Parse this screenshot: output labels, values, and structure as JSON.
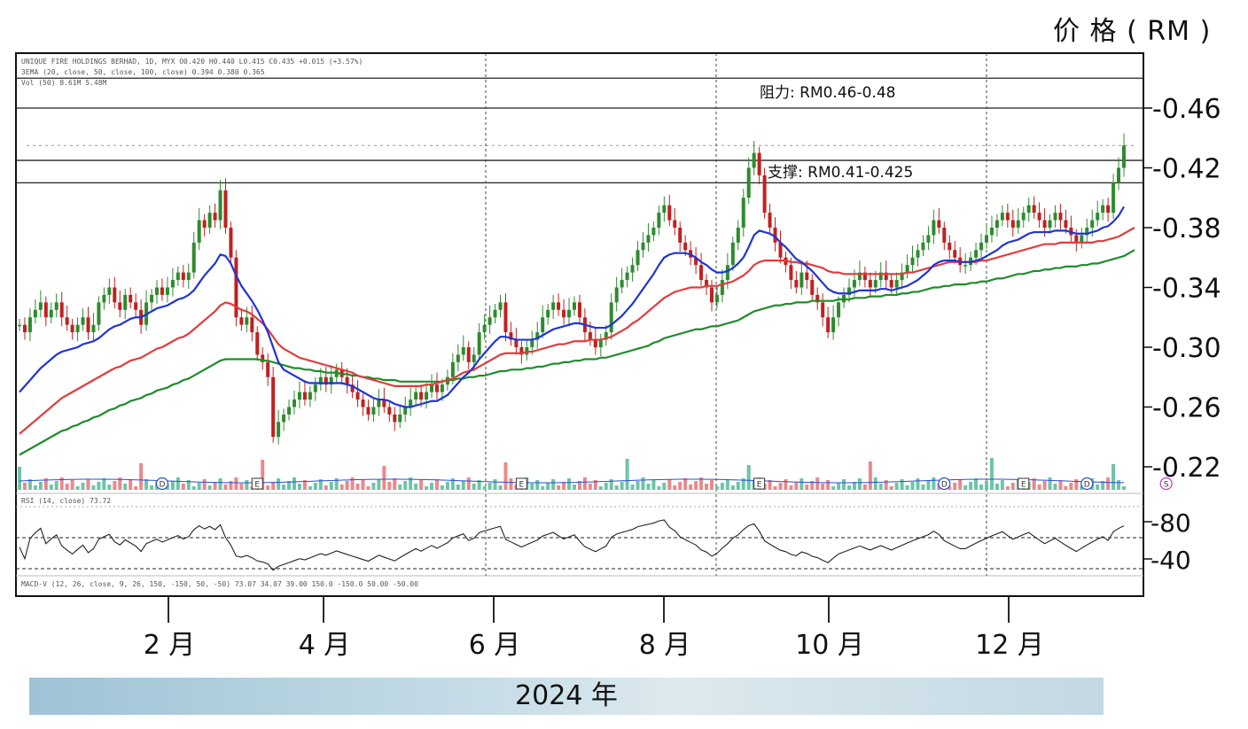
{
  "unit_label": "价 格 ( RM )",
  "header": {
    "line1": "UNIQUE FIRE HOLDINGS BERHAD, 1D, MYX  O0.420  H0.440  L0.415  C0.435  +0.015 (+3.57%)",
    "line2": "3EMA (20, close, 50, close, 100, close)  0.394  0.380  0.365",
    "line3": "Vol (50)  8.61M  5.48M",
    "rsi": "RSI (14, close)  73.72",
    "macd": "MACD-V (12, 26, close, 9, 26, 150, -150, 50, -50)  73.07  34.07  39.00  150.0  -150.0  50.00  -50.00"
  },
  "annotations": {
    "resistance": "阻力: RM0.46-0.48",
    "support": "支撑: RM0.41-0.425"
  },
  "year_label": "2024 年",
  "colors": {
    "ema20": "#1f34d6",
    "ema50": "#e03c3c",
    "ema100": "#1e8c2a",
    "candle_up": "#2e8b2e",
    "candle_down": "#c02020",
    "vol_up": "#6fc4a8",
    "vol_down": "#e88a8a"
  },
  "chart_data": {
    "type": "candlestick",
    "yaxis": {
      "ticks": [
        0.46,
        0.42,
        0.38,
        0.34,
        0.3,
        0.26,
        0.22
      ],
      "ylim": [
        0.21,
        0.48
      ]
    },
    "rsi_axis": {
      "ticks": [
        80,
        40
      ],
      "ylim": [
        20,
        100
      ]
    },
    "xaxis": {
      "ticks": [
        "2 月",
        "4 月",
        "6 月",
        "8 月",
        "10 月",
        "12 月"
      ],
      "tick_index": [
        33,
        66,
        98,
        130,
        162,
        197
      ]
    },
    "resistance_lines": [
      0.46,
      0.48
    ],
    "support_lines": [
      0.41,
      0.425
    ],
    "dotted_level": 0.435,
    "event_lines_index": [
      95,
      146,
      187
    ],
    "event_markers": [
      {
        "i": 27,
        "label": "D"
      },
      {
        "i": 45,
        "label": "E"
      },
      {
        "i": 95,
        "label": "E"
      },
      {
        "i": 140,
        "label": "E"
      },
      {
        "i": 175,
        "label": "D"
      },
      {
        "i": 190,
        "label": "E"
      },
      {
        "i": 202,
        "label": "D"
      },
      {
        "i": 217,
        "label": "S"
      }
    ],
    "close": [
      0.315,
      0.31,
      0.32,
      0.325,
      0.33,
      0.32,
      0.325,
      0.33,
      0.32,
      0.315,
      0.31,
      0.315,
      0.32,
      0.31,
      0.315,
      0.33,
      0.335,
      0.34,
      0.33,
      0.325,
      0.335,
      0.33,
      0.325,
      0.315,
      0.33,
      0.335,
      0.34,
      0.335,
      0.34,
      0.345,
      0.35,
      0.345,
      0.35,
      0.37,
      0.385,
      0.38,
      0.39,
      0.385,
      0.405,
      0.38,
      0.36,
      0.32,
      0.315,
      0.32,
      0.31,
      0.295,
      0.29,
      0.28,
      0.24,
      0.25,
      0.255,
      0.26,
      0.265,
      0.27,
      0.265,
      0.27,
      0.275,
      0.28,
      0.275,
      0.28,
      0.285,
      0.28,
      0.275,
      0.27,
      0.265,
      0.26,
      0.255,
      0.26,
      0.265,
      0.26,
      0.255,
      0.25,
      0.255,
      0.26,
      0.265,
      0.27,
      0.265,
      0.27,
      0.275,
      0.27,
      0.275,
      0.28,
      0.29,
      0.295,
      0.3,
      0.29,
      0.295,
      0.31,
      0.315,
      0.32,
      0.325,
      0.33,
      0.31,
      0.305,
      0.3,
      0.295,
      0.3,
      0.305,
      0.31,
      0.32,
      0.325,
      0.33,
      0.325,
      0.32,
      0.325,
      0.33,
      0.32,
      0.31,
      0.305,
      0.3,
      0.305,
      0.31,
      0.33,
      0.34,
      0.345,
      0.35,
      0.355,
      0.365,
      0.37,
      0.375,
      0.38,
      0.39,
      0.395,
      0.385,
      0.38,
      0.37,
      0.365,
      0.36,
      0.355,
      0.345,
      0.34,
      0.33,
      0.335,
      0.345,
      0.355,
      0.37,
      0.38,
      0.4,
      0.42,
      0.43,
      0.415,
      0.39,
      0.38,
      0.37,
      0.36,
      0.355,
      0.345,
      0.34,
      0.35,
      0.345,
      0.335,
      0.33,
      0.32,
      0.31,
      0.32,
      0.33,
      0.335,
      0.34,
      0.345,
      0.35,
      0.345,
      0.34,
      0.345,
      0.35,
      0.345,
      0.34,
      0.345,
      0.35,
      0.355,
      0.36,
      0.365,
      0.37,
      0.375,
      0.385,
      0.38,
      0.37,
      0.365,
      0.36,
      0.355,
      0.355,
      0.36,
      0.365,
      0.37,
      0.375,
      0.38,
      0.385,
      0.39,
      0.385,
      0.38,
      0.385,
      0.39,
      0.395,
      0.39,
      0.385,
      0.38,
      0.385,
      0.39,
      0.385,
      0.38,
      0.375,
      0.37,
      0.375,
      0.38,
      0.385,
      0.39,
      0.395,
      0.39,
      0.41,
      0.42,
      0.435
    ],
    "ema20": [
      0.27,
      0.274,
      0.278,
      0.282,
      0.286,
      0.289,
      0.292,
      0.295,
      0.297,
      0.298,
      0.299,
      0.3,
      0.302,
      0.303,
      0.304,
      0.306,
      0.309,
      0.312,
      0.314,
      0.315,
      0.317,
      0.319,
      0.32,
      0.32,
      0.322,
      0.324,
      0.326,
      0.327,
      0.328,
      0.33,
      0.332,
      0.333,
      0.335,
      0.338,
      0.343,
      0.348,
      0.352,
      0.356,
      0.362,
      0.361,
      0.356,
      0.348,
      0.341,
      0.336,
      0.331,
      0.325,
      0.318,
      0.31,
      0.3,
      0.29,
      0.285,
      0.283,
      0.281,
      0.279,
      0.277,
      0.276,
      0.276,
      0.276,
      0.276,
      0.276,
      0.276,
      0.276,
      0.275,
      0.274,
      0.272,
      0.27,
      0.268,
      0.266,
      0.265,
      0.265,
      0.264,
      0.262,
      0.261,
      0.26,
      0.26,
      0.261,
      0.262,
      0.263,
      0.264,
      0.264,
      0.266,
      0.268,
      0.272,
      0.276,
      0.28,
      0.283,
      0.287,
      0.292,
      0.296,
      0.3,
      0.304,
      0.307,
      0.307,
      0.306,
      0.305,
      0.305,
      0.305,
      0.305,
      0.306,
      0.308,
      0.31,
      0.312,
      0.313,
      0.314,
      0.315,
      0.316,
      0.316,
      0.315,
      0.314,
      0.313,
      0.313,
      0.313,
      0.315,
      0.318,
      0.321,
      0.325,
      0.329,
      0.334,
      0.339,
      0.344,
      0.349,
      0.355,
      0.36,
      0.362,
      0.363,
      0.363,
      0.363,
      0.362,
      0.36,
      0.357,
      0.355,
      0.352,
      0.35,
      0.35,
      0.351,
      0.353,
      0.356,
      0.36,
      0.367,
      0.375,
      0.378,
      0.377,
      0.376,
      0.374,
      0.37,
      0.367,
      0.363,
      0.359,
      0.357,
      0.354,
      0.351,
      0.347,
      0.343,
      0.339,
      0.337,
      0.336,
      0.336,
      0.336,
      0.337,
      0.338,
      0.338,
      0.338,
      0.338,
      0.339,
      0.339,
      0.338,
      0.339,
      0.34,
      0.341,
      0.343,
      0.345,
      0.348,
      0.351,
      0.355,
      0.357,
      0.358,
      0.358,
      0.358,
      0.357,
      0.357,
      0.357,
      0.358,
      0.359,
      0.361,
      0.363,
      0.365,
      0.368,
      0.37,
      0.371,
      0.372,
      0.374,
      0.376,
      0.377,
      0.377,
      0.377,
      0.377,
      0.378,
      0.378,
      0.378,
      0.377,
      0.376,
      0.376,
      0.376,
      0.377,
      0.378,
      0.38,
      0.381,
      0.384,
      0.388,
      0.394
    ],
    "ema50": [
      0.242,
      0.245,
      0.248,
      0.251,
      0.254,
      0.257,
      0.26,
      0.263,
      0.266,
      0.268,
      0.27,
      0.272,
      0.274,
      0.276,
      0.278,
      0.28,
      0.282,
      0.284,
      0.286,
      0.287,
      0.289,
      0.291,
      0.292,
      0.293,
      0.295,
      0.297,
      0.299,
      0.3,
      0.302,
      0.304,
      0.306,
      0.307,
      0.309,
      0.312,
      0.315,
      0.318,
      0.321,
      0.324,
      0.328,
      0.33,
      0.329,
      0.327,
      0.325,
      0.324,
      0.322,
      0.319,
      0.316,
      0.312,
      0.307,
      0.302,
      0.299,
      0.297,
      0.295,
      0.293,
      0.292,
      0.291,
      0.29,
      0.289,
      0.288,
      0.287,
      0.286,
      0.285,
      0.284,
      0.283,
      0.281,
      0.28,
      0.279,
      0.278,
      0.277,
      0.276,
      0.275,
      0.274,
      0.274,
      0.274,
      0.274,
      0.274,
      0.274,
      0.275,
      0.275,
      0.276,
      0.277,
      0.278,
      0.279,
      0.281,
      0.283,
      0.284,
      0.285,
      0.287,
      0.289,
      0.291,
      0.293,
      0.295,
      0.296,
      0.296,
      0.296,
      0.296,
      0.297,
      0.297,
      0.298,
      0.299,
      0.3,
      0.301,
      0.302,
      0.302,
      0.303,
      0.304,
      0.304,
      0.304,
      0.305,
      0.305,
      0.305,
      0.306,
      0.307,
      0.309,
      0.311,
      0.313,
      0.316,
      0.318,
      0.321,
      0.324,
      0.327,
      0.33,
      0.333,
      0.335,
      0.337,
      0.338,
      0.339,
      0.34,
      0.34,
      0.34,
      0.341,
      0.341,
      0.341,
      0.342,
      0.343,
      0.344,
      0.346,
      0.348,
      0.351,
      0.355,
      0.357,
      0.358,
      0.358,
      0.358,
      0.358,
      0.358,
      0.357,
      0.357,
      0.356,
      0.356,
      0.355,
      0.354,
      0.353,
      0.351,
      0.35,
      0.35,
      0.349,
      0.349,
      0.349,
      0.349,
      0.349,
      0.349,
      0.349,
      0.349,
      0.349,
      0.349,
      0.349,
      0.349,
      0.35,
      0.35,
      0.351,
      0.352,
      0.353,
      0.354,
      0.355,
      0.356,
      0.357,
      0.357,
      0.357,
      0.357,
      0.357,
      0.357,
      0.358,
      0.358,
      0.359,
      0.36,
      0.361,
      0.362,
      0.363,
      0.364,
      0.365,
      0.366,
      0.367,
      0.368,
      0.369,
      0.369,
      0.369,
      0.37,
      0.37,
      0.37,
      0.37,
      0.37,
      0.37,
      0.37,
      0.371,
      0.371,
      0.372,
      0.373,
      0.374,
      0.376,
      0.378,
      0.38
    ],
    "ema100": [
      0.228,
      0.23,
      0.232,
      0.234,
      0.236,
      0.238,
      0.24,
      0.242,
      0.244,
      0.245,
      0.247,
      0.248,
      0.25,
      0.251,
      0.253,
      0.254,
      0.256,
      0.258,
      0.259,
      0.261,
      0.262,
      0.264,
      0.265,
      0.266,
      0.268,
      0.269,
      0.271,
      0.272,
      0.273,
      0.275,
      0.276,
      0.278,
      0.279,
      0.281,
      0.283,
      0.285,
      0.287,
      0.289,
      0.291,
      0.292,
      0.292,
      0.292,
      0.292,
      0.292,
      0.292,
      0.292,
      0.291,
      0.291,
      0.29,
      0.289,
      0.288,
      0.287,
      0.286,
      0.286,
      0.285,
      0.285,
      0.284,
      0.284,
      0.283,
      0.283,
      0.283,
      0.282,
      0.282,
      0.281,
      0.281,
      0.28,
      0.28,
      0.279,
      0.279,
      0.278,
      0.278,
      0.278,
      0.277,
      0.277,
      0.277,
      0.277,
      0.277,
      0.277,
      0.277,
      0.277,
      0.277,
      0.278,
      0.278,
      0.279,
      0.279,
      0.28,
      0.28,
      0.281,
      0.281,
      0.282,
      0.283,
      0.284,
      0.284,
      0.285,
      0.285,
      0.285,
      0.286,
      0.286,
      0.287,
      0.287,
      0.288,
      0.289,
      0.289,
      0.29,
      0.29,
      0.291,
      0.291,
      0.292,
      0.292,
      0.292,
      0.293,
      0.293,
      0.294,
      0.295,
      0.296,
      0.297,
      0.298,
      0.299,
      0.3,
      0.301,
      0.303,
      0.304,
      0.306,
      0.307,
      0.308,
      0.309,
      0.31,
      0.311,
      0.312,
      0.312,
      0.313,
      0.314,
      0.314,
      0.315,
      0.316,
      0.317,
      0.318,
      0.32,
      0.322,
      0.324,
      0.325,
      0.326,
      0.327,
      0.328,
      0.328,
      0.329,
      0.329,
      0.33,
      0.33,
      0.33,
      0.331,
      0.331,
      0.331,
      0.331,
      0.331,
      0.332,
      0.332,
      0.332,
      0.333,
      0.333,
      0.333,
      0.334,
      0.334,
      0.334,
      0.335,
      0.335,
      0.335,
      0.336,
      0.336,
      0.337,
      0.337,
      0.338,
      0.339,
      0.34,
      0.34,
      0.341,
      0.341,
      0.342,
      0.342,
      0.342,
      0.343,
      0.343,
      0.344,
      0.344,
      0.345,
      0.346,
      0.346,
      0.347,
      0.348,
      0.349,
      0.349,
      0.35,
      0.351,
      0.351,
      0.352,
      0.352,
      0.353,
      0.353,
      0.354,
      0.354,
      0.354,
      0.355,
      0.355,
      0.356,
      0.356,
      0.357,
      0.358,
      0.359,
      0.36,
      0.361,
      0.363,
      0.365
    ],
    "rsi_note": "RSI line derived from close series; last value 73.72"
  }
}
